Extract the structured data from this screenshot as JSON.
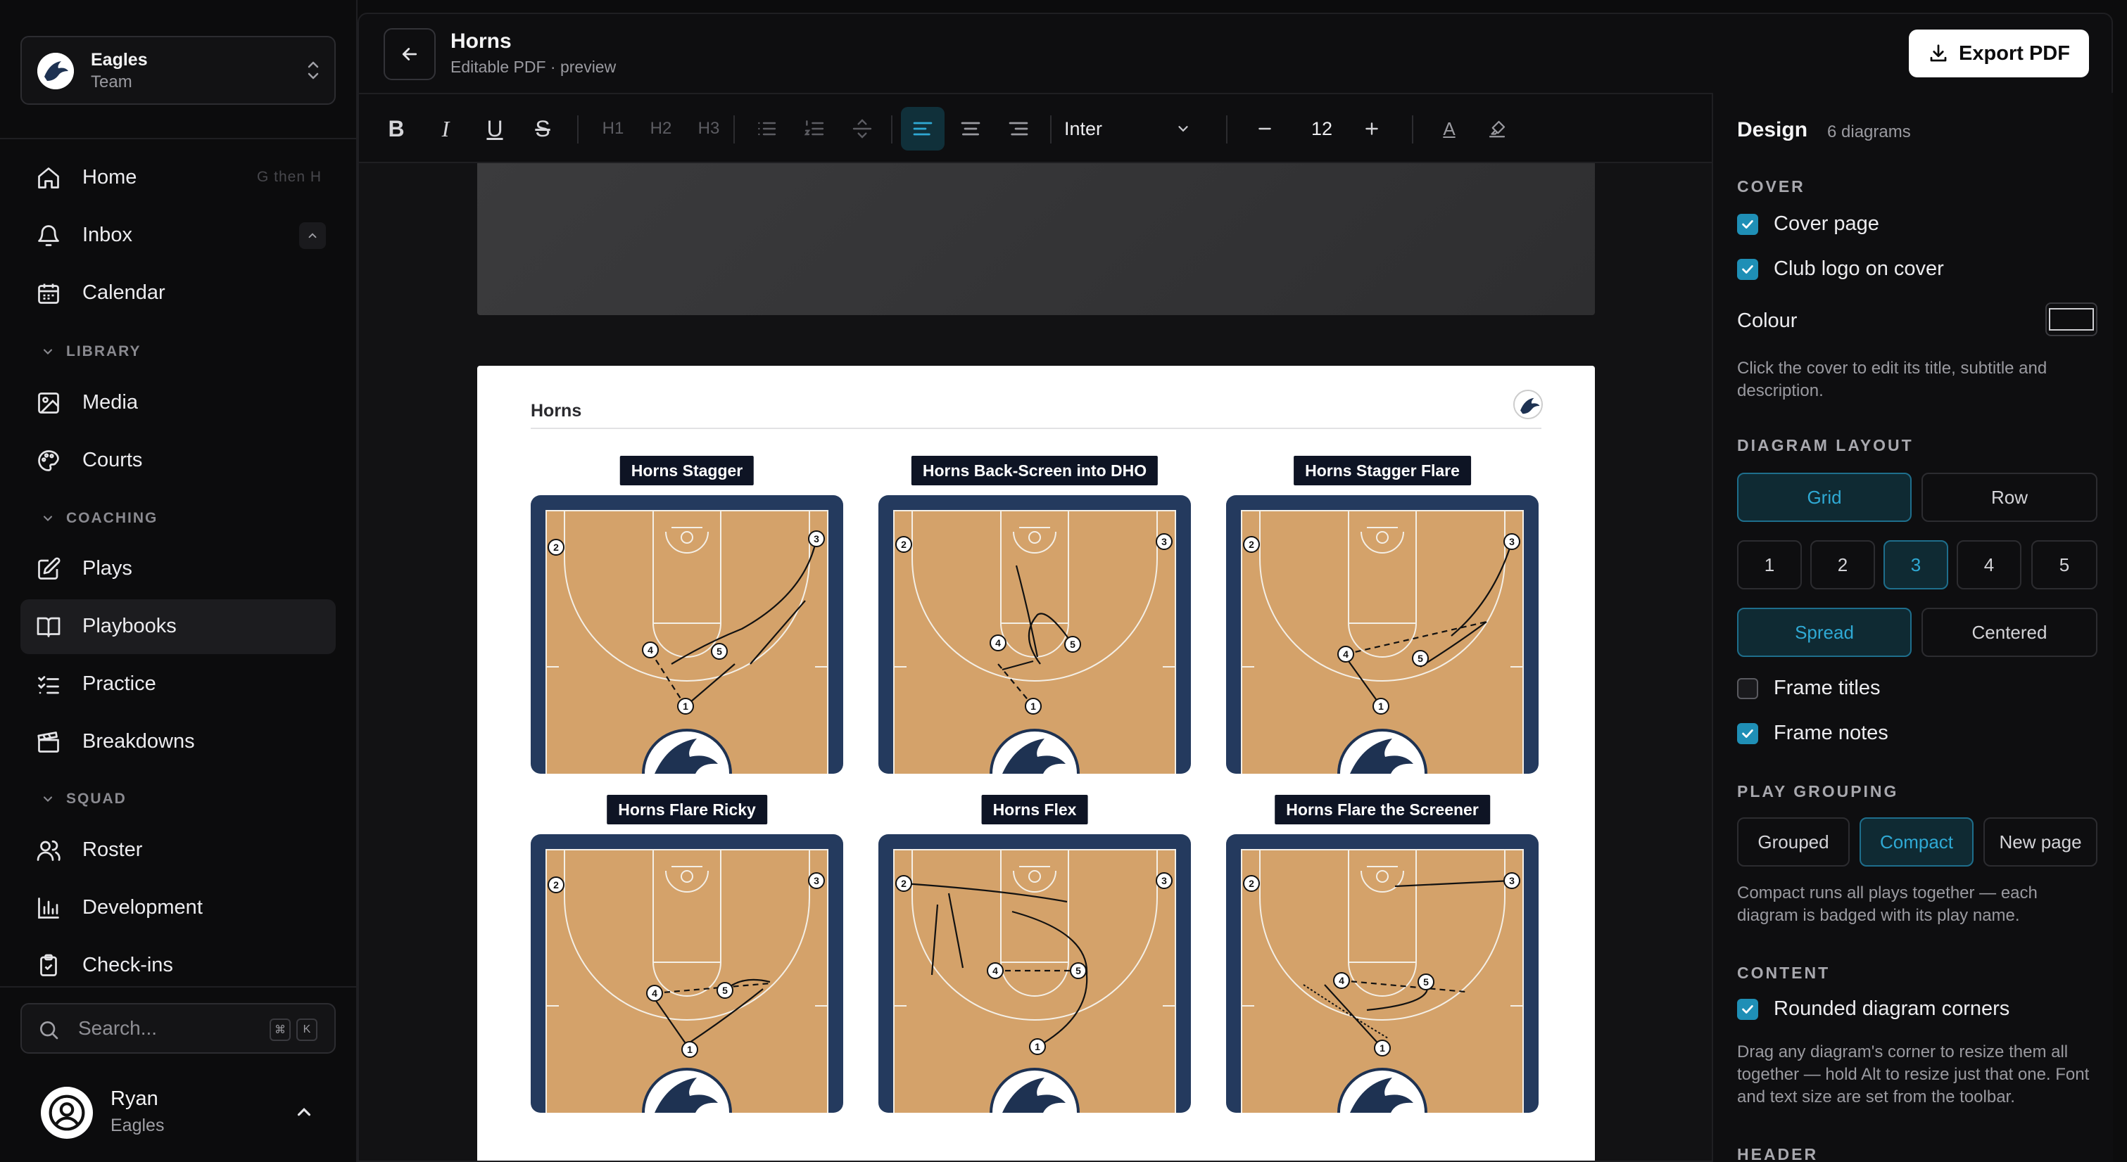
{
  "sidebar": {
    "team": {
      "name": "Eagles",
      "subtitle": "Team"
    },
    "nav": [
      {
        "label": "Home",
        "icon": "home-icon",
        "hint": "G then H"
      },
      {
        "label": "Inbox",
        "icon": "bell-icon"
      },
      {
        "label": "Calendar",
        "icon": "calendar-icon"
      }
    ],
    "sections": [
      {
        "title": "LIBRARY",
        "items": [
          {
            "label": "Media",
            "icon": "image-icon"
          },
          {
            "label": "Courts",
            "icon": "palette-icon"
          }
        ]
      },
      {
        "title": "COACHING",
        "items": [
          {
            "label": "Plays",
            "icon": "pencil-square-icon"
          },
          {
            "label": "Playbooks",
            "icon": "book-open-icon",
            "active": true
          },
          {
            "label": "Practice",
            "icon": "list-checks-icon"
          },
          {
            "label": "Breakdowns",
            "icon": "clapperboard-icon"
          }
        ]
      },
      {
        "title": "SQUAD",
        "items": [
          {
            "label": "Roster",
            "icon": "users-icon"
          },
          {
            "label": "Development",
            "icon": "bar-chart-icon"
          },
          {
            "label": "Check-ins",
            "icon": "clipboard-check-icon"
          }
        ]
      }
    ],
    "search": {
      "placeholder": "Search...",
      "kbd1": "⌘",
      "kbd2": "K"
    },
    "user": {
      "name": "Ryan",
      "team": "Eagles"
    }
  },
  "header": {
    "title": "Horns",
    "subtitle": "Editable PDF · preview",
    "export_label": "Export PDF"
  },
  "toolbar": {
    "font": "Inter",
    "font_size": "12",
    "h1": "H1",
    "h2": "H2",
    "h3": "H3",
    "bold": "B",
    "italic": "I",
    "underline": "U",
    "strike": "S",
    "color_glyph": "A"
  },
  "page": {
    "title": "Horns",
    "diagrams": [
      {
        "title": "Horns Stagger"
      },
      {
        "title": "Horns Back-Screen into DHO"
      },
      {
        "title": "Horns Stagger Flare"
      },
      {
        "title": "Horns Flare Ricky"
      },
      {
        "title": "Horns Flex"
      },
      {
        "title": "Horns Flare the Screener"
      }
    ],
    "players": [
      "1",
      "2",
      "3",
      "4",
      "5"
    ]
  },
  "panel": {
    "title": "Design",
    "count": "6 diagrams",
    "cover": {
      "heading": "COVER",
      "cover_page": "Cover page",
      "club_logo": "Club logo on cover",
      "colour": "Colour",
      "help": "Click the cover to edit its title, subtitle and description."
    },
    "layout": {
      "heading": "DIAGRAM LAYOUT",
      "grid": "Grid",
      "row": "Row",
      "columns": [
        "1",
        "2",
        "3",
        "4",
        "5"
      ],
      "selected_columns": "3",
      "spread": "Spread",
      "centered": "Centered",
      "frame_titles": "Frame titles",
      "frame_notes": "Frame notes"
    },
    "grouping": {
      "heading": "PLAY GROUPING",
      "grouped": "Grouped",
      "compact": "Compact",
      "new_page": "New page",
      "help": "Compact runs all plays together — each diagram is badged with its play name."
    },
    "content": {
      "heading": "CONTENT",
      "rounded": "Rounded diagram corners",
      "help": "Drag any diagram's corner to resize them all together — hold Alt to resize just that one. Font and text size are set from the toolbar."
    },
    "header_heading": "HEADER"
  },
  "colors": {
    "accent": "#2596be",
    "court_wood": "#d4a26a",
    "court_frame": "#243a5e"
  }
}
